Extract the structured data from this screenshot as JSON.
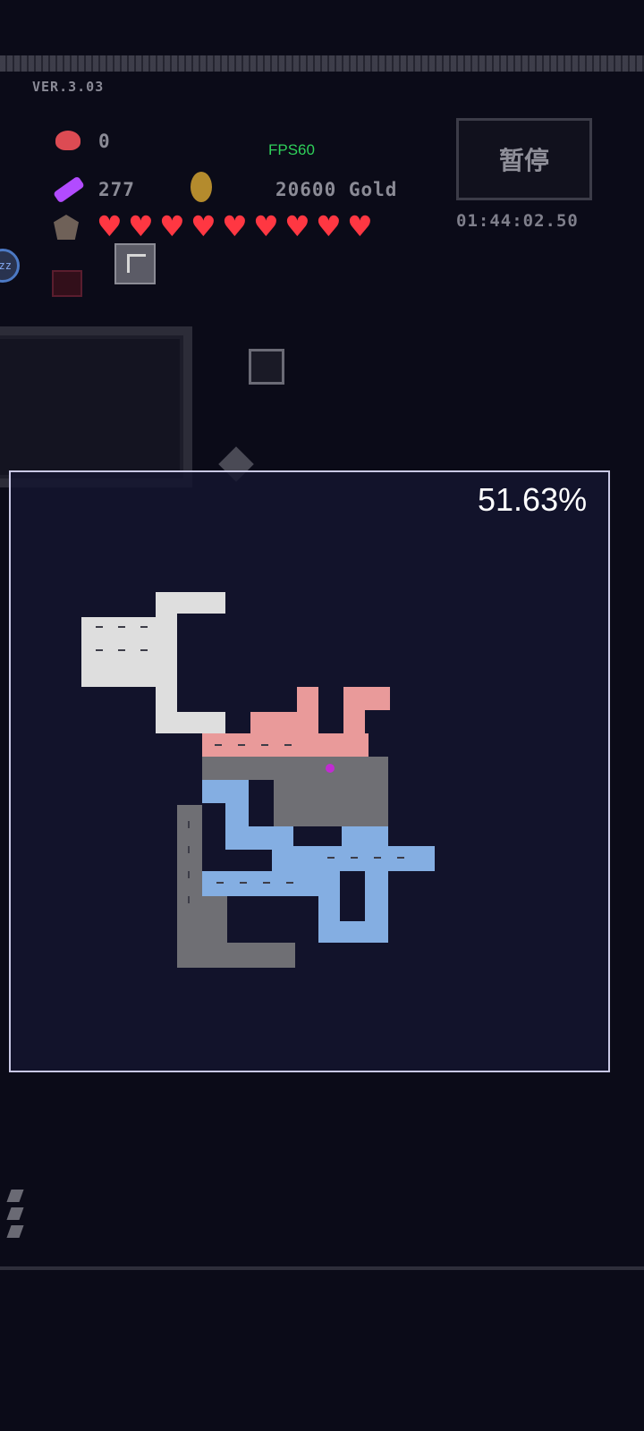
{
  "hud": {
    "version": "VER.3.03",
    "potion_count": "0",
    "fps": "FPS60",
    "energy": "277",
    "gold": "20600 Gold",
    "hearts_count": 9,
    "pause_label": "暂停",
    "timer": "01:44:02.50",
    "sleep_badge": "zz"
  },
  "map": {
    "explored_percent": "51.63%"
  },
  "colors": {
    "heart": "#ff3742",
    "fps": "#2fd05a",
    "map_border": "#c9c8e5"
  }
}
